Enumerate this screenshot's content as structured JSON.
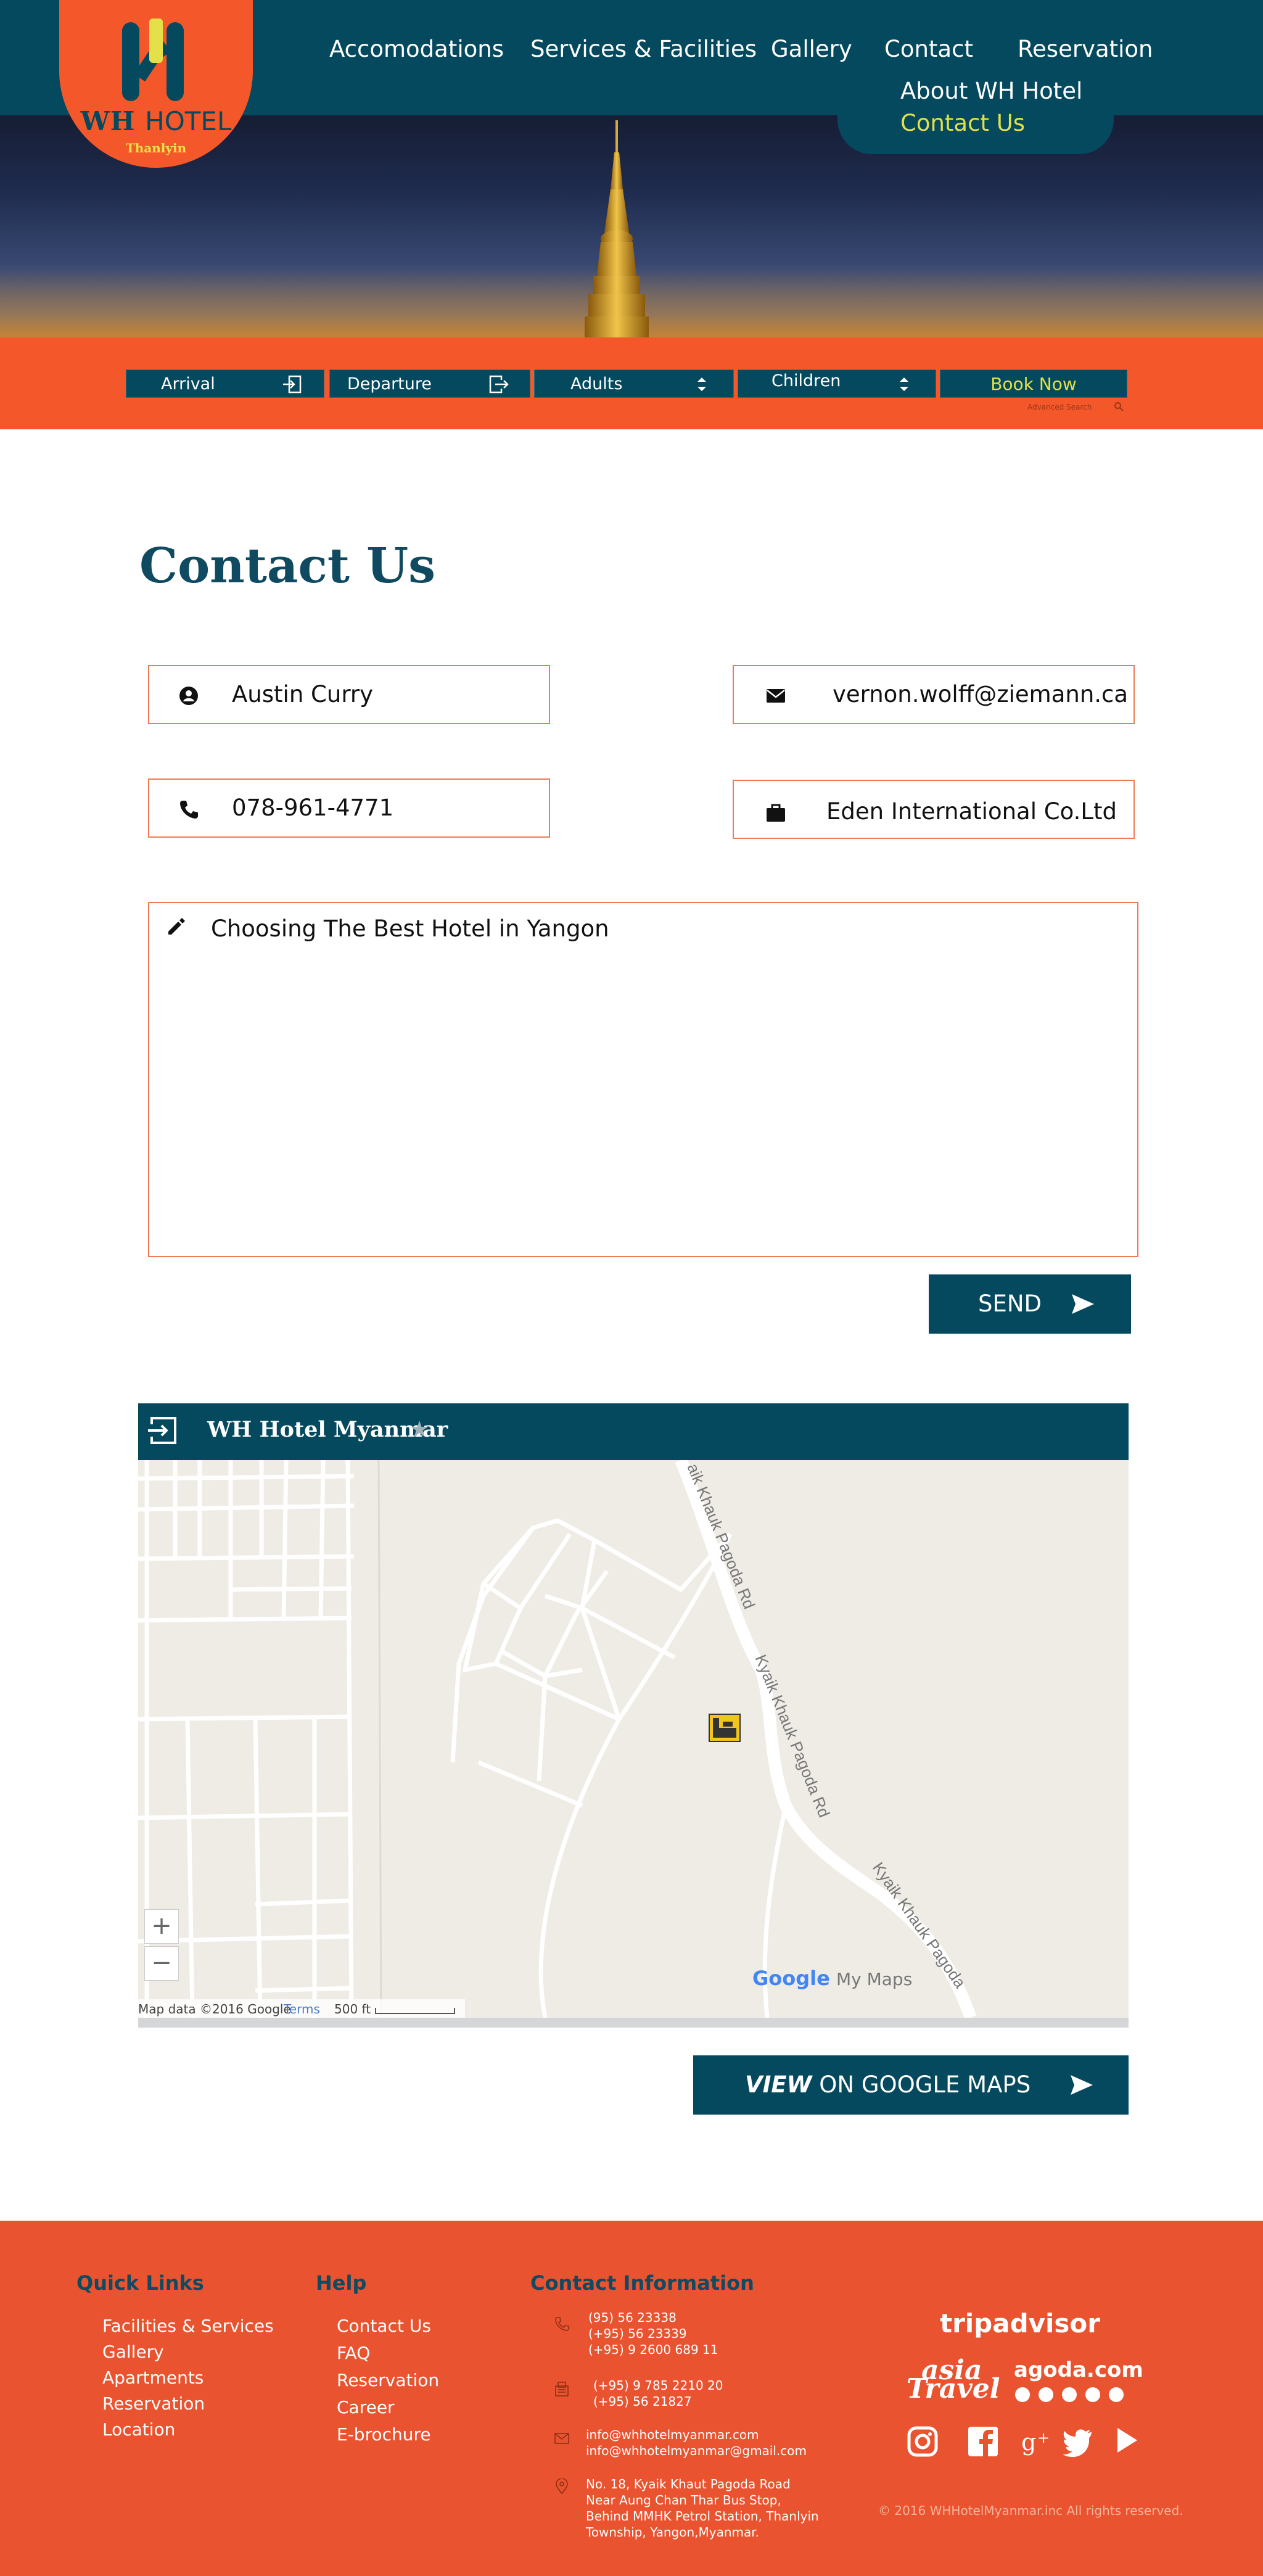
{
  "brand": {
    "logo_name": "WH",
    "logo_name_suffix": "HOTEL",
    "logo_location": "Thanlyin",
    "logo_icon": "wh-monogram-icon",
    "primary_color": "#04495d",
    "accent_color": "#f4582a",
    "highlight_color": "#e3e04a"
  },
  "nav": {
    "items": [
      "Accomodations",
      "Services & Facilities",
      "Gallery",
      "Contact",
      "Reservation"
    ],
    "contact_submenu": [
      "About WH Hotel",
      "Contact Us"
    ]
  },
  "booking": {
    "arrival": "Arrival",
    "departure": "Departure",
    "adults": "Adults",
    "children": "Children",
    "book_now": "Book Now",
    "advanced_search": "Advanced Search",
    "icons": [
      "calendar-in-icon",
      "calendar-out-icon",
      "select-arrows-icon",
      "search-icon"
    ]
  },
  "contact": {
    "title": "Contact Us",
    "name": "Austin Curry",
    "email": "vernon.wolff@ziemann.ca",
    "phone": "078-961-4771",
    "company": "Eden International Co.Ltd",
    "message": "Choosing The Best Hotel in Yangon",
    "send_label": "SEND",
    "icons": [
      "user-icon",
      "envelope-icon",
      "phone-icon",
      "briefcase-icon",
      "pencil-icon",
      "send-arrow-icon"
    ]
  },
  "map": {
    "title": "WH Hotel Myanmar",
    "road_labels": [
      "aik Khauk Pagoda Rd",
      "Kyaik Khauk Pagoda Rd",
      "Kyaik Khauk Pagoda"
    ],
    "zoom_in": "+",
    "zoom_out": "−",
    "attribution": "Map data ©2016 Google",
    "terms": "Terms",
    "scale": "500 ft",
    "google_logo": "Google",
    "my_maps": "My Maps",
    "view_prefix": "VIEW",
    "view_rest": " ON GOOGLE MAPS",
    "icons": [
      "sign-in-icon",
      "star-icon",
      "hotel-marker-icon"
    ]
  },
  "footer": {
    "quick_links_title": "Quick Links",
    "quick_links": [
      "Facilities & Services",
      "Gallery",
      "Apartments",
      "Reservation",
      "Location"
    ],
    "help_title": "Help",
    "help_links": [
      "Contact Us",
      "FAQ",
      "Reservation",
      "Career",
      "E-brochure"
    ],
    "contact_title": "Contact Information",
    "phones": [
      "(95) 56 23338",
      "(+95) 56 23339",
      "(+95) 9 2600 689 11"
    ],
    "fax": [
      "(+95) 9 785 2210 20",
      "(+95) 56 21827"
    ],
    "emails": [
      "info@whhotelmyanmar.com",
      "info@whhotelmyanmar@gmail.com"
    ],
    "address": [
      "No. 18, Kyaik Khaut Pagoda Road",
      "Near Aung Chan Thar Bus Stop,",
      "Behind MMHK Petrol Station, Thanlyin",
      "Township, Yangon,Myanmar."
    ],
    "tripadvisor": "tripadvisor",
    "asia_travel_1": "asia",
    "asia_travel_2": "Travel",
    "agoda": "agoda.com",
    "copyright": "© 2016 WHHotelMyanmar.inc All rights reserved.",
    "social": [
      "instagram-icon",
      "facebook-icon",
      "google-plus-icon",
      "twitter-icon",
      "youtube-icon"
    ]
  }
}
